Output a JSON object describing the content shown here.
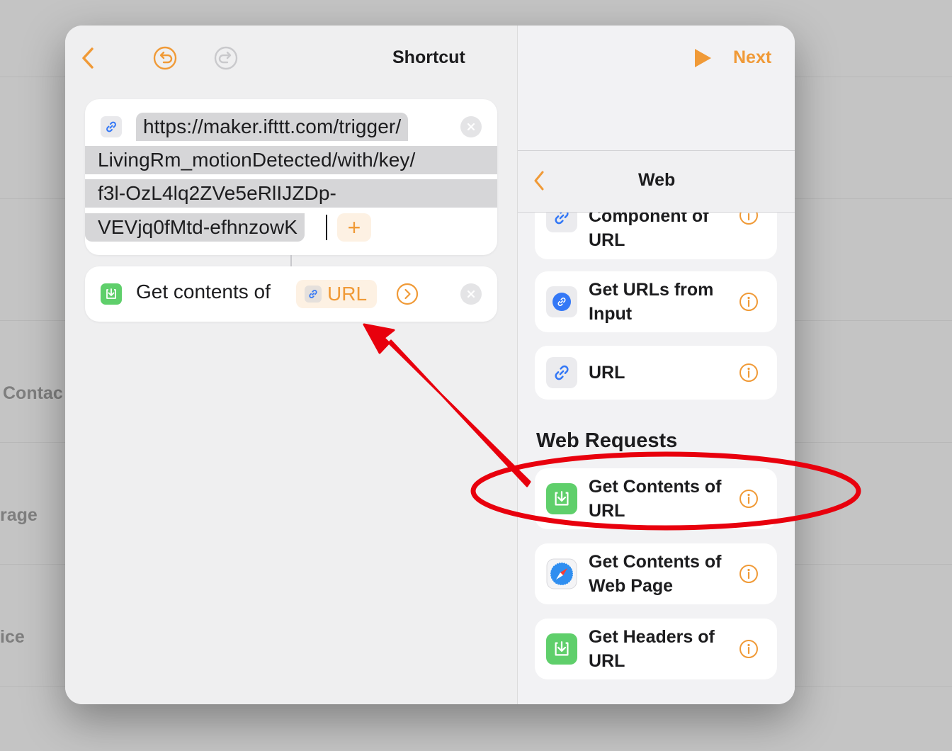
{
  "background": {
    "labels": [
      "Contac",
      "rage",
      "ice"
    ]
  },
  "header": {
    "title": "Shortcut",
    "next_label": "Next",
    "back_icon": "chevron-left-icon",
    "undo_icon": "undo-icon",
    "redo_icon": "redo-icon",
    "run_icon": "play-icon"
  },
  "url_action": {
    "lines": [
      "https://maker.ifttt.com/trigger/",
      "LivingRm_motionDetected/with/key/",
      "f3l-OzL4lq2ZVe5eRlIJZDp-",
      "VEVjq0fMtd-efhnzowK"
    ],
    "add_label": "+"
  },
  "get_contents_action": {
    "label": "Get contents of",
    "token_label": "URL"
  },
  "web_panel": {
    "title": "Web",
    "items_top": [
      {
        "label": "Component of URL",
        "icon": "link-icon"
      },
      {
        "label": "Get URLs from Input",
        "icon": "link-badge-icon"
      },
      {
        "label": "URL",
        "icon": "link-icon"
      }
    ],
    "section_title": "Web Requests",
    "items_requests": [
      {
        "label": "Get Contents of URL",
        "icon": "download-icon"
      },
      {
        "label": "Get Contents of Web Page",
        "icon": "safari-compass-icon"
      },
      {
        "label": "Get Headers of URL",
        "icon": "download-icon"
      }
    ]
  },
  "colors": {
    "accent": "#f09a37",
    "annotation_red": "#e8000d",
    "green_action": "#5fcf6b",
    "link_blue": "#3478f6"
  }
}
